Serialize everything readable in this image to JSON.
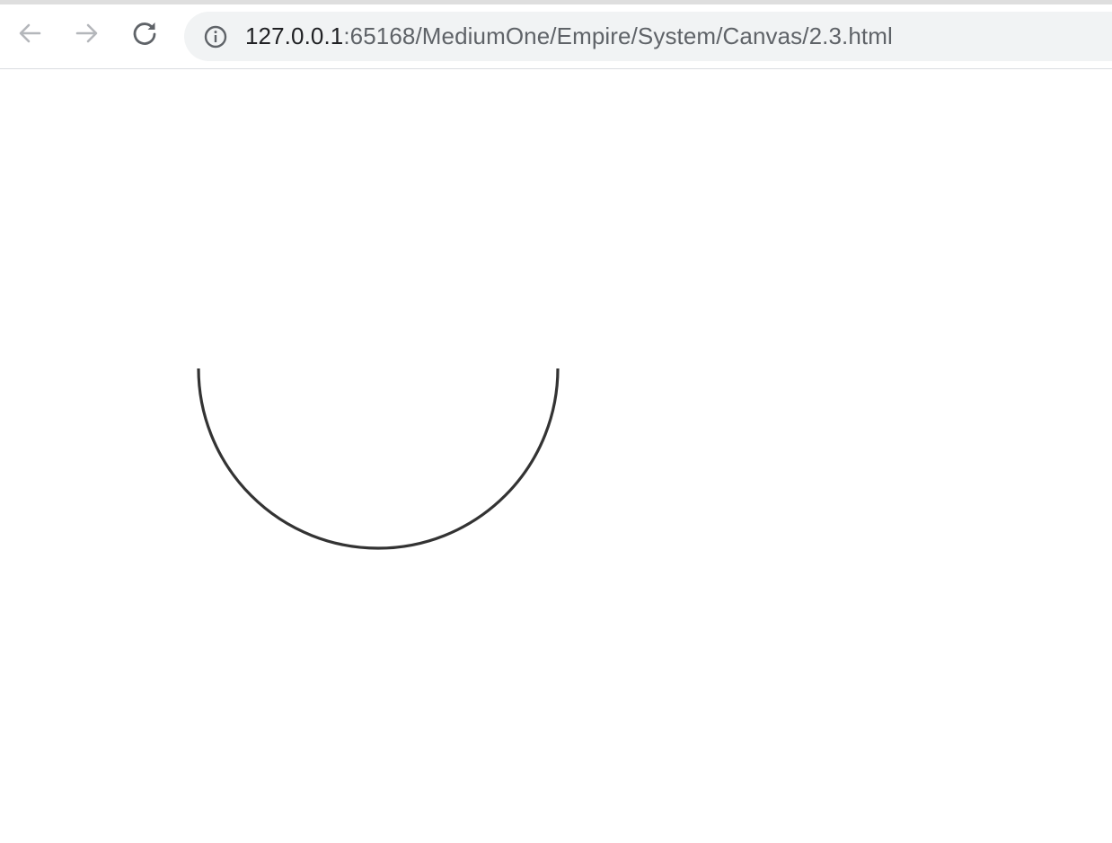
{
  "browser": {
    "address_bar": {
      "host": "127.0.0.1",
      "path": ":65168/MediumOne/Empire/System/Canvas/2.3.html"
    },
    "icons": {
      "back": "arrow-left-icon",
      "forward": "arrow-right-icon",
      "reload": "reload-icon",
      "site_info": "info-icon"
    }
  },
  "page": {
    "canvas": {
      "shape": "arc",
      "arc": "lower semicircle",
      "stroke_color": "#333333"
    }
  }
}
